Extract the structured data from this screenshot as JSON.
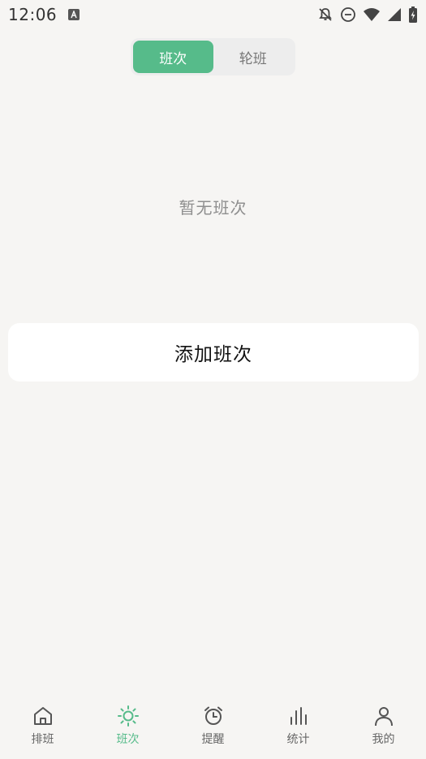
{
  "status_bar": {
    "time": "12:06",
    "icons": [
      "app-a-icon",
      "bell-off-icon",
      "do-not-disturb-icon",
      "wifi-icon",
      "signal-icon",
      "battery-charging-icon"
    ]
  },
  "segmented": {
    "tabs": [
      {
        "label": "班次",
        "active": true
      },
      {
        "label": "轮班",
        "active": false
      }
    ]
  },
  "empty_state": {
    "text": "暂无班次"
  },
  "add_button": {
    "label": "添加班次"
  },
  "bottom_nav": {
    "items": [
      {
        "label": "排班",
        "icon": "home-icon",
        "active": false
      },
      {
        "label": "班次",
        "icon": "sun-icon",
        "active": true
      },
      {
        "label": "提醒",
        "icon": "alarm-clock-icon",
        "active": false
      },
      {
        "label": "统计",
        "icon": "bar-chart-icon",
        "active": false
      },
      {
        "label": "我的",
        "icon": "person-icon",
        "active": false
      }
    ]
  },
  "colors": {
    "accent": "#56bb8a",
    "background": "#f6f5f3",
    "inactive_label": "#666666",
    "empty_text": "#8f8f8f"
  }
}
